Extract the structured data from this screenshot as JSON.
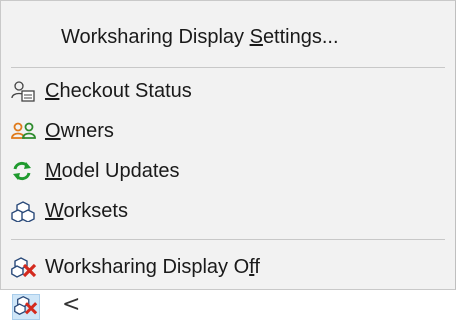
{
  "menu": {
    "settings": {
      "label_pre": "Worksharing Display ",
      "label_u": "S",
      "label_post": "ettings..."
    },
    "checkout": {
      "label_u": "C",
      "label_post": "heckout Status",
      "icon": "checkout-status-icon"
    },
    "owners": {
      "label_u": "O",
      "label_post": "wners",
      "icon": "owners-icon"
    },
    "model_updates": {
      "label_u": "M",
      "label_post": "odel Updates",
      "icon": "model-updates-icon"
    },
    "worksets": {
      "label_u": "W",
      "label_post": "orksets",
      "icon": "worksets-icon"
    },
    "display_off": {
      "label_pre": "Worksharing Display O",
      "label_u": "f",
      "label_post": "f",
      "icon": "worksharing-display-off-icon"
    }
  },
  "taskbar": {
    "arrow": "<",
    "icon": "worksharing-display-icon"
  },
  "colors": {
    "owners_orange": "#e07a1a",
    "owners_green": "#2e8b2e",
    "model_updates_green": "#1f9a2e",
    "off_red": "#d42a1e",
    "highlight_blue": "#cfe6f8"
  }
}
